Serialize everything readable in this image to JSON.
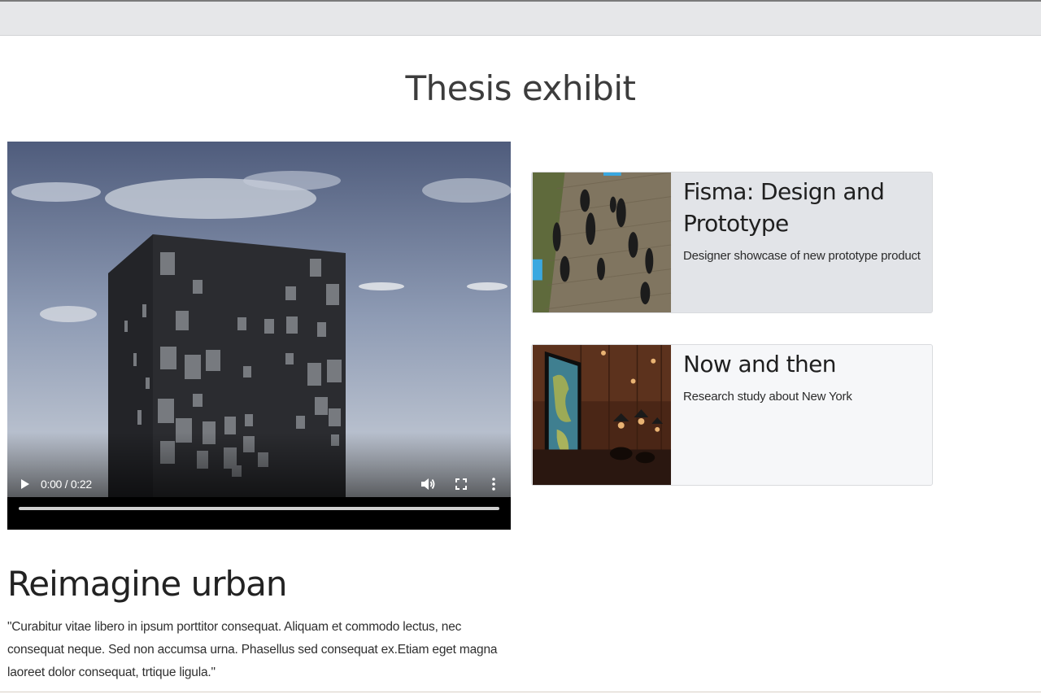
{
  "page": {
    "title": "Thesis exhibit"
  },
  "video": {
    "time_display": "0:00 / 0:22",
    "progress": 0,
    "icons": [
      "play-icon",
      "volume-icon",
      "fullscreen-icon",
      "more-options-icon"
    ]
  },
  "projects": [
    {
      "title": "Fisma: Design and Prototype",
      "description": "Designer showcase of new prototype product"
    },
    {
      "title": "Now and then",
      "description": "Research study about New York"
    }
  ],
  "feature": {
    "title": "Reimagine urban",
    "quote": "\"Curabitur vitae libero in ipsum porttitor consequat. Aliquam et commodo lectus, nec consequat neque. Sed non accumsa urna. Phasellus sed consequat ex.Etiam eget magna laoreet dolor consequat, trtique ligula.\""
  },
  "colors": {
    "card_primary_bg": "#e2e4e8",
    "card_secondary_bg": "#f6f7f9",
    "heading": "#3c3c3c"
  }
}
